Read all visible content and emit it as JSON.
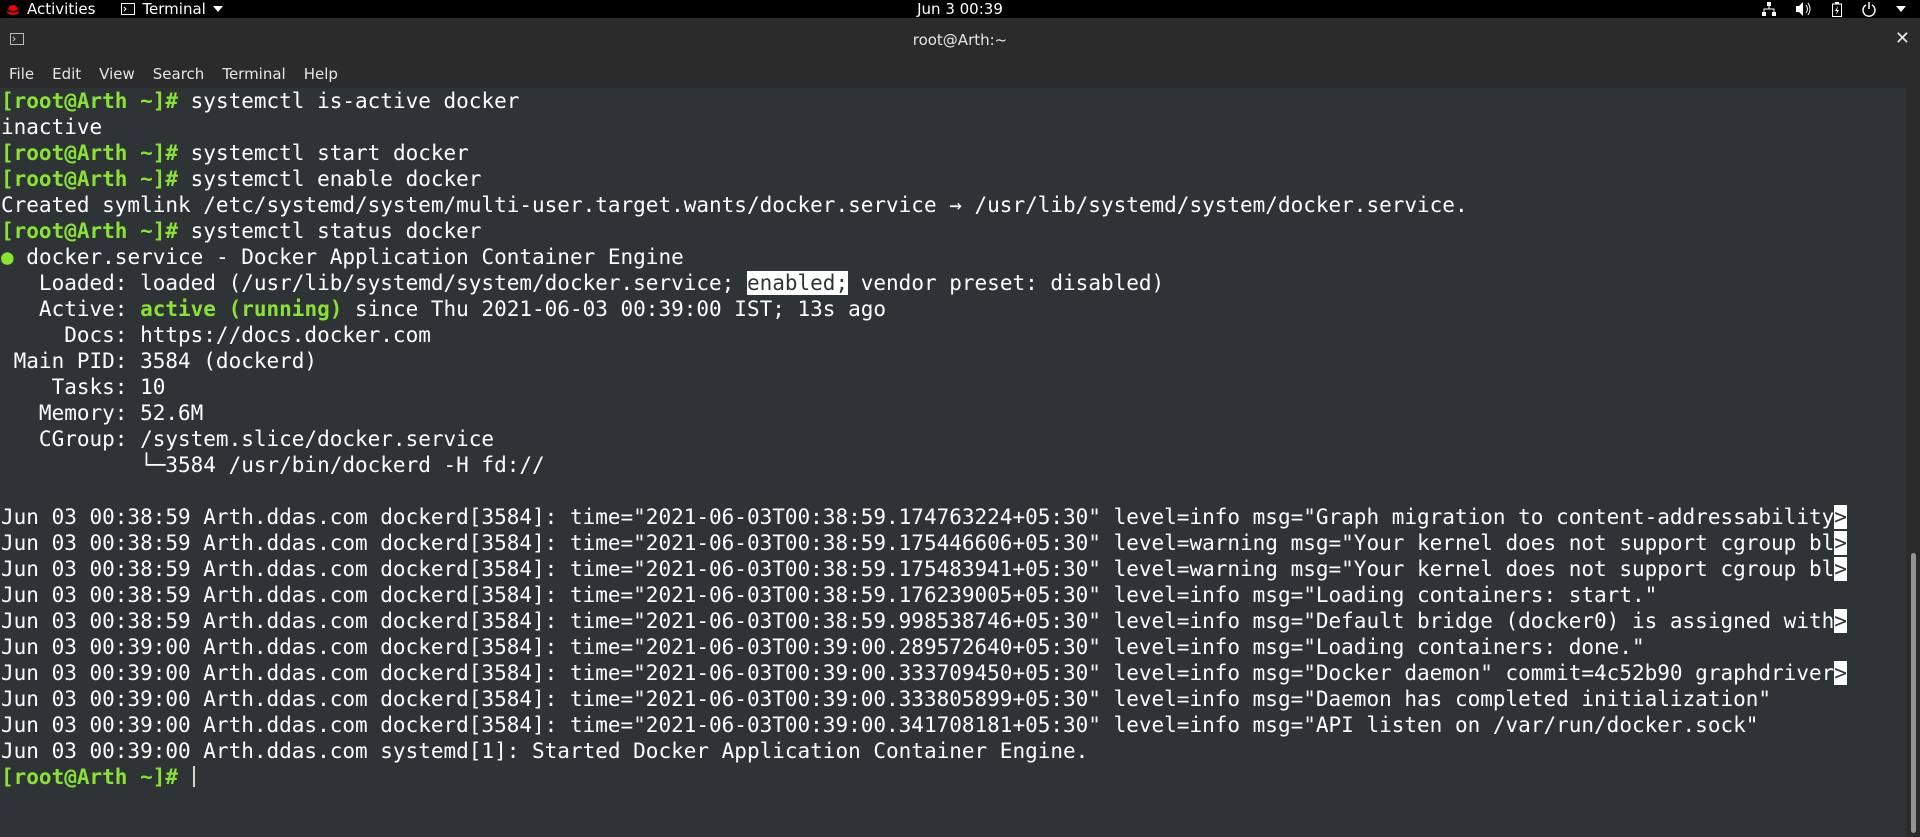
{
  "topbar": {
    "activities": "Activities",
    "app_menu": "Terminal",
    "clock": "Jun 3  00:39"
  },
  "window": {
    "title": "root@Arth:~",
    "close_glyph": "✕"
  },
  "menu": [
    "File",
    "Edit",
    "View",
    "Search",
    "Terminal",
    "Help"
  ],
  "terminal": {
    "prompt": "[root@Arth ~]#",
    "cmd1": " systemctl is-active docker",
    "out1": "inactive",
    "cmd2": " systemctl start docker",
    "cmd3": " systemctl enable docker",
    "symlink": "Created symlink /etc/systemd/system/multi-user.target.wants/docker.service → /usr/lib/systemd/system/docker.service.",
    "cmd4": " systemctl status docker",
    "status": {
      "dot": "●",
      "unit": " docker.service - Docker Application Container Engine",
      "loaded_pre": "   Loaded: loaded (/usr/lib/systemd/system/docker.service; ",
      "loaded_hl": "enabled;",
      "loaded_post": " vendor preset: disabled)",
      "active_pre": "   Active: ",
      "active_state": "active (running)",
      "active_post": " since Thu 2021-06-03 00:39:00 IST; 13s ago",
      "docs": "     Docs: https://docs.docker.com",
      "pid": " Main PID: 3584 (dockerd)",
      "tasks": "    Tasks: 10",
      "memory": "   Memory: 52.6M",
      "cgroup": "   CGroup: /system.slice/docker.service",
      "cgroup_child": "           └─3584 /usr/bin/dockerd -H fd://"
    },
    "log_lines": [
      "Jun 03 00:38:59 Arth.ddas.com dockerd[3584]: time=\"2021-06-03T00:38:59.174763224+05:30\" level=info msg=\"Graph migration to content-addressability",
      "Jun 03 00:38:59 Arth.ddas.com dockerd[3584]: time=\"2021-06-03T00:38:59.175446606+05:30\" level=warning msg=\"Your kernel does not support cgroup bl",
      "Jun 03 00:38:59 Arth.ddas.com dockerd[3584]: time=\"2021-06-03T00:38:59.175483941+05:30\" level=warning msg=\"Your kernel does not support cgroup bl",
      "Jun 03 00:38:59 Arth.ddas.com dockerd[3584]: time=\"2021-06-03T00:38:59.176239005+05:30\" level=info msg=\"Loading containers: start.\"",
      "Jun 03 00:38:59 Arth.ddas.com dockerd[3584]: time=\"2021-06-03T00:38:59.998538746+05:30\" level=info msg=\"Default bridge (docker0) is assigned with",
      "Jun 03 00:39:00 Arth.ddas.com dockerd[3584]: time=\"2021-06-03T00:39:00.289572640+05:30\" level=info msg=\"Loading containers: done.\"",
      "Jun 03 00:39:00 Arth.ddas.com dockerd[3584]: time=\"2021-06-03T00:39:00.333709450+05:30\" level=info msg=\"Docker daemon\" commit=4c52b90 graphdriver",
      "Jun 03 00:39:00 Arth.ddas.com dockerd[3584]: time=\"2021-06-03T00:39:00.333805899+05:30\" level=info msg=\"Daemon has completed initialization\"",
      "Jun 03 00:39:00 Arth.ddas.com dockerd[3584]: time=\"2021-06-03T00:39:00.341708181+05:30\" level=info msg=\"API listen on /var/run/docker.sock\"",
      "Jun 03 00:39:00 Arth.ddas.com systemd[1]: Started Docker Application Container Engine."
    ],
    "trunc_marker": ">"
  },
  "colors": {
    "terminal_bg": "#2e3436",
    "prompt_green": "#8ae234",
    "chrome_dark": "#2b2b2b"
  },
  "icons": [
    "redhat-logo-icon",
    "terminal-icon",
    "chevron-down-icon",
    "network-icon",
    "volume-icon",
    "battery-icon",
    "power-icon",
    "terminal-window-icon",
    "close-icon"
  ]
}
